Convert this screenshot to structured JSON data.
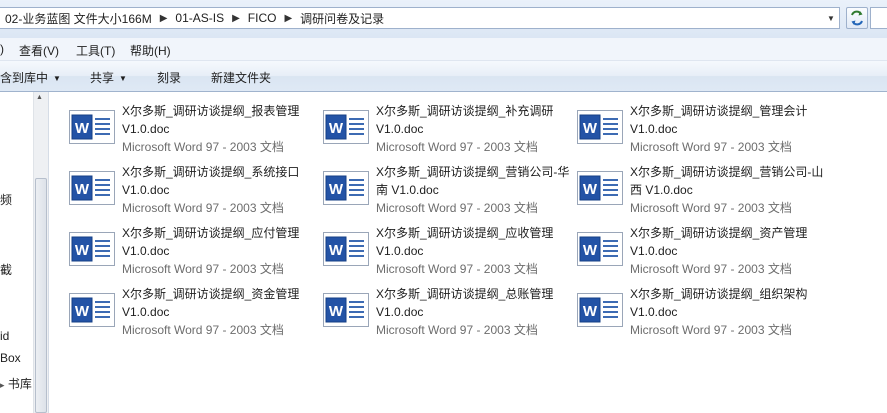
{
  "address_bar": {
    "crumbs": [
      "02-业务蓝图 文件大小166M",
      "01-AS-IS",
      "FICO",
      "调研问卷及记录"
    ]
  },
  "menu": {
    "items": [
      {
        "key": "view",
        "label": "查看(V)"
      },
      {
        "key": "tools",
        "label": "工具(T)"
      },
      {
        "key": "help",
        "label": "帮助(H)"
      }
    ],
    "partial_left": ")"
  },
  "toolbar": {
    "include_library": "含到库中",
    "share": "共享",
    "burn": "刻录",
    "new_folder": "新建文件夹"
  },
  "nav": {
    "labels": [
      "频",
      "截",
      "id",
      "Box",
      "书库"
    ]
  },
  "files": [
    {
      "name": "X尔多斯_调研访谈提纲_报表管理 V1.0.doc",
      "type": "Microsoft Word 97 - 2003 文档"
    },
    {
      "name": "X尔多斯_调研访谈提纲_补充调研 V1.0.doc",
      "type": "Microsoft Word 97 - 2003 文档"
    },
    {
      "name": "X尔多斯_调研访谈提纲_管理会计 V1.0.doc",
      "type": "Microsoft Word 97 - 2003 文档"
    },
    {
      "name": "X尔多斯_调研访谈提纲_系统接口 V1.0.doc",
      "type": "Microsoft Word 97 - 2003 文档"
    },
    {
      "name": "X尔多斯_调研访谈提纲_营销公司-华南 V1.0.doc",
      "type": "Microsoft Word 97 - 2003 文档"
    },
    {
      "name": "X尔多斯_调研访谈提纲_营销公司-山西 V1.0.doc",
      "type": "Microsoft Word 97 - 2003 文档"
    },
    {
      "name": "X尔多斯_调研访谈提纲_应付管理 V1.0.doc",
      "type": "Microsoft Word 97 - 2003 文档"
    },
    {
      "name": "X尔多斯_调研访谈提纲_应收管理 V1.0.doc",
      "type": "Microsoft Word 97 - 2003 文档"
    },
    {
      "name": "X尔多斯_调研访谈提纲_资产管理 V1.0.doc",
      "type": "Microsoft Word 97 - 2003 文档"
    },
    {
      "name": "X尔多斯_调研访谈提纲_资金管理 V1.0.doc",
      "type": "Microsoft Word 97 - 2003 文档"
    },
    {
      "name": "X尔多斯_调研访谈提纲_总账管理 V1.0.doc",
      "type": "Microsoft Word 97 - 2003 文档"
    },
    {
      "name": "X尔多斯_调研访谈提纲_组织架构 V1.0.doc",
      "type": "Microsoft Word 97 - 2003 文档"
    }
  ]
}
